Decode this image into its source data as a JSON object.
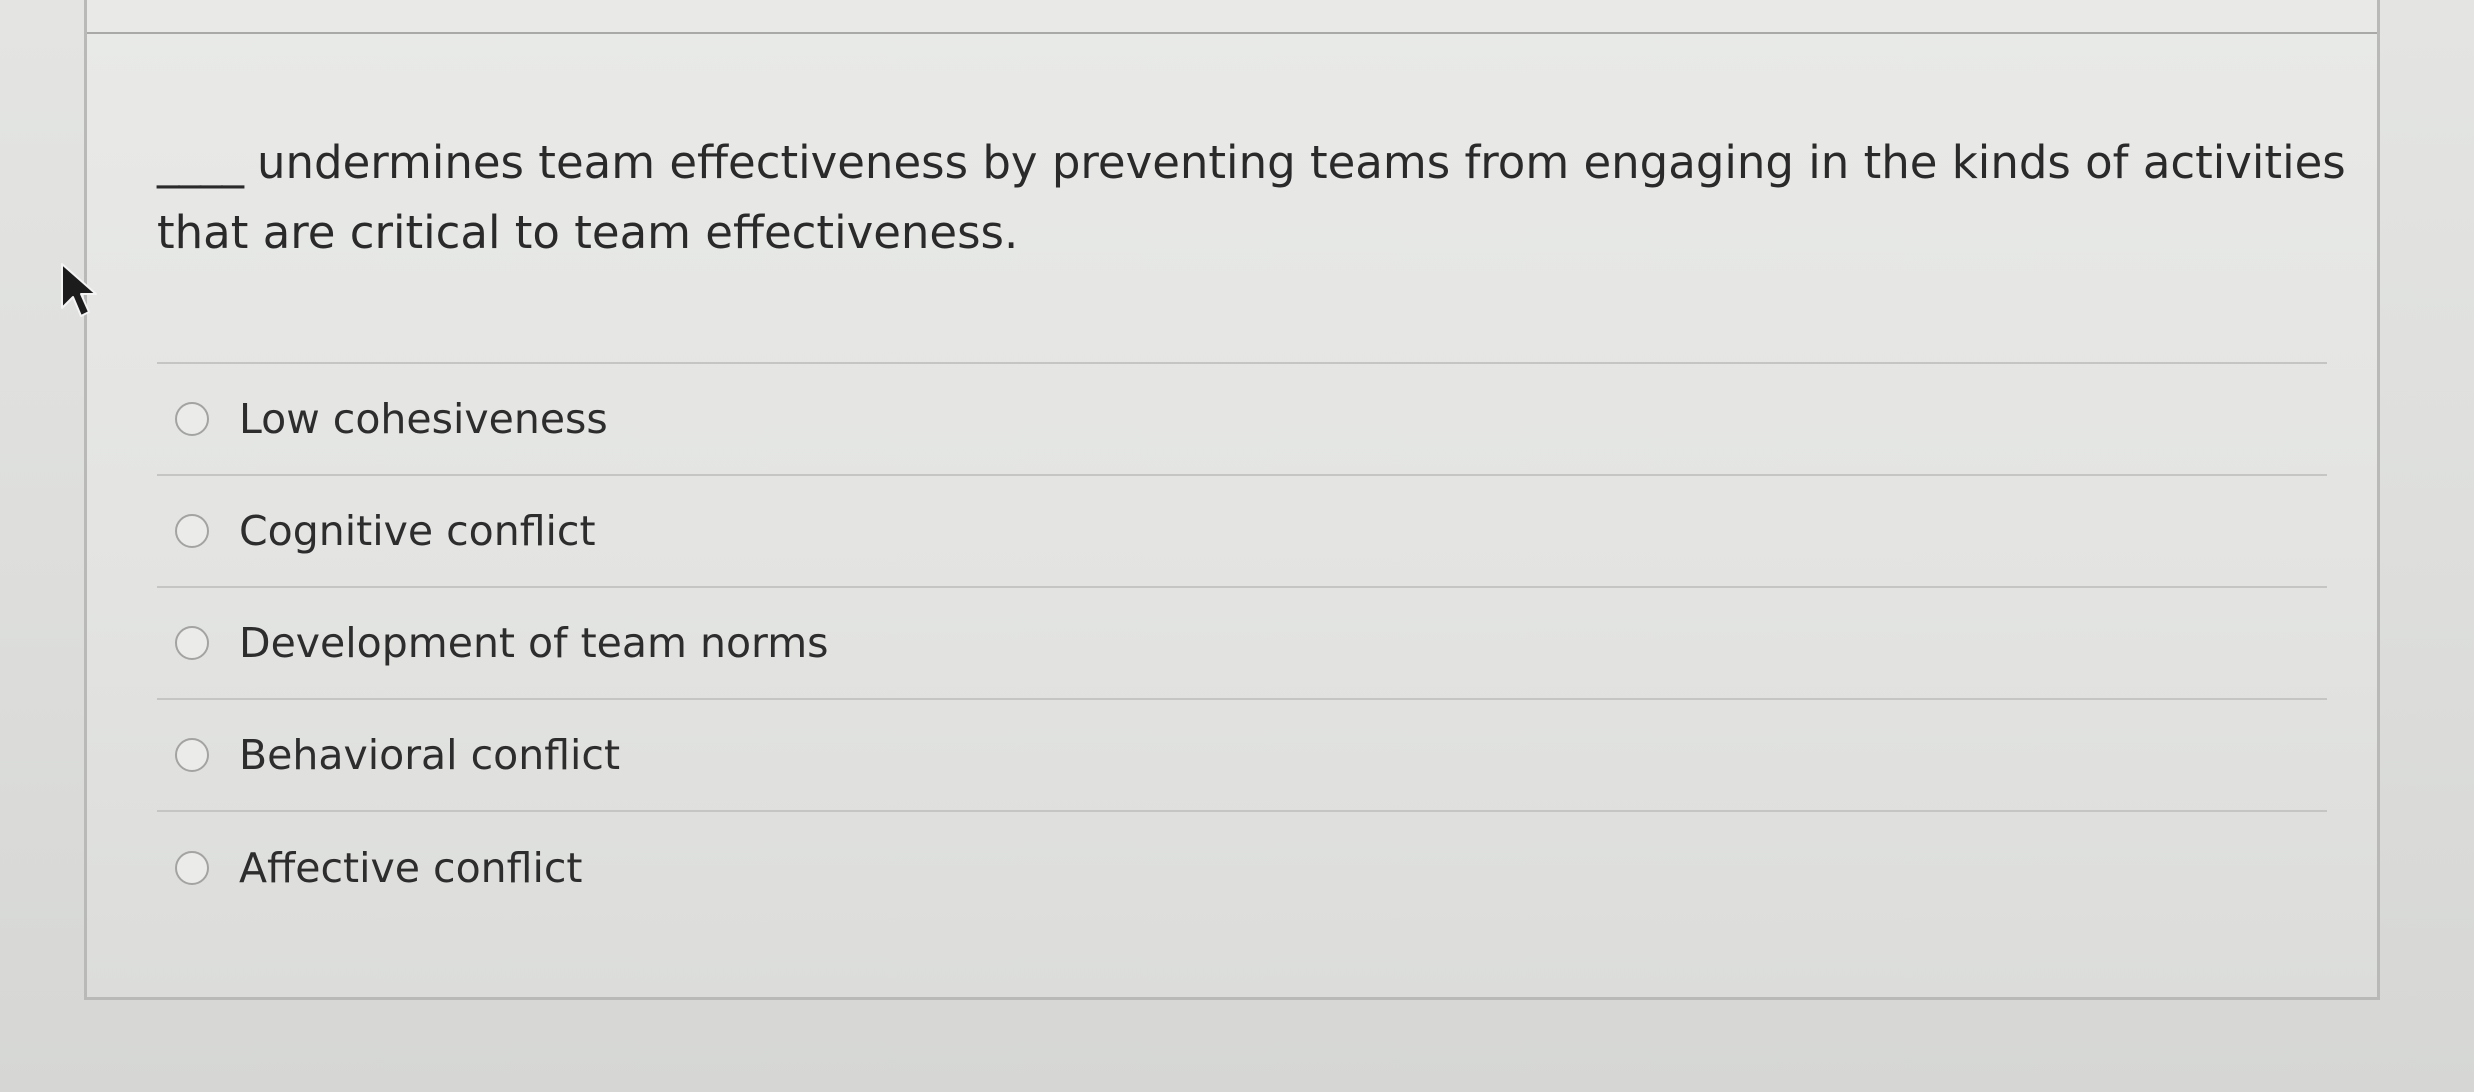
{
  "question": {
    "blank": "____",
    "text": "undermines team effectiveness by preventing teams from engaging in the kinds of activities that are critical to team effectiveness."
  },
  "answers": [
    {
      "label": "Low cohesiveness",
      "selected": false
    },
    {
      "label": "Cognitive conflict",
      "selected": false
    },
    {
      "label": "Development of team norms",
      "selected": false
    },
    {
      "label": "Behavioral conflict",
      "selected": false
    },
    {
      "label": "Affective conflict",
      "selected": false
    }
  ],
  "icons": {
    "radio": "radio-button-icon",
    "cursor": "mouse-pointer-icon"
  },
  "colors": {
    "background": "#e0e1df",
    "text": "#2d2d2d",
    "divider": "#c5c6c4"
  }
}
